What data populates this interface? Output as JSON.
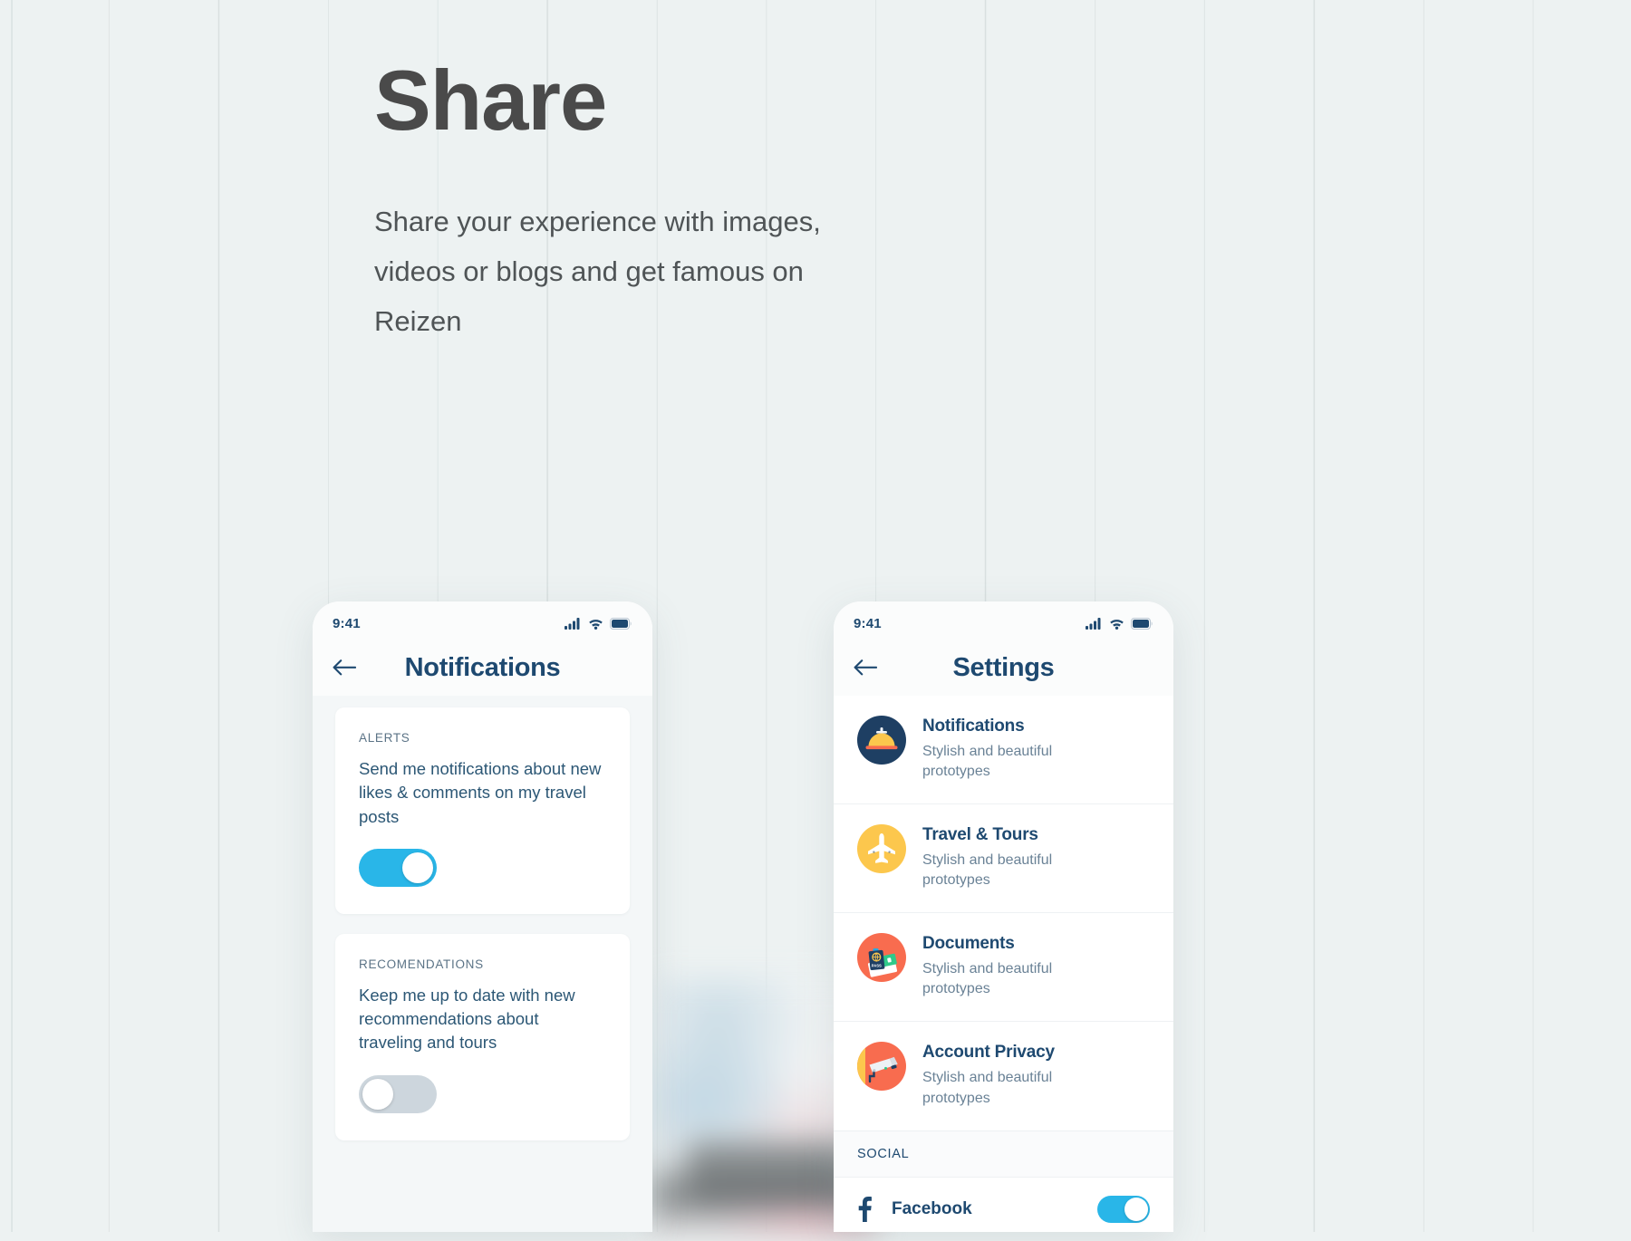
{
  "hero": {
    "title": "Share",
    "subtitle": "Share your experience with images, videos or blogs and get famous on Reizen"
  },
  "colors": {
    "background": "#edf2f2",
    "grid_line": "#d9e0e0",
    "heading": "#4a4a4a",
    "body_text": "#4f5456",
    "navy": "#1e4970",
    "accent_blue": "#29b6e8",
    "toggle_off": "#cdd6dd",
    "icon_yellow": "#fcc74d",
    "icon_orange": "#f86c4f",
    "icon_navy": "#1e3f63",
    "card_bg": "#ffffff",
    "phone_body_bg": "#f4f7f8"
  },
  "phone_notifications": {
    "status": {
      "time": "9:41",
      "signal_icon": "cellular-signal-icon",
      "wifi_icon": "wifi-icon",
      "battery_icon": "battery-icon"
    },
    "nav": {
      "back_icon": "arrow-left-icon",
      "title": "Notifications"
    },
    "cards": [
      {
        "kicker": "ALERTS",
        "text": "Send me notifications about new likes & comments on my travel posts",
        "toggle_state": "on"
      },
      {
        "kicker": "RECOMENDATIONS",
        "text": "Keep me up to date with new recommendations about traveling and tours",
        "toggle_state": "off"
      }
    ]
  },
  "phone_settings": {
    "status": {
      "time": "9:41",
      "signal_icon": "cellular-signal-icon",
      "wifi_icon": "wifi-icon",
      "battery_icon": "battery-icon"
    },
    "nav": {
      "back_icon": "arrow-left-icon",
      "title": "Settings"
    },
    "items": [
      {
        "title": "Notifications",
        "desc": "Stylish and beautiful prototypes",
        "icon": "service-bell-icon",
        "icon_bg": "#1e3f63"
      },
      {
        "title": "Travel & Tours",
        "desc": "Stylish and beautiful prototypes",
        "icon": "airplane-icon",
        "icon_bg": "#fcc74d"
      },
      {
        "title": "Documents",
        "desc": "Stylish and beautiful prototypes",
        "icon": "passport-documents-icon",
        "icon_bg": "#f86c4f"
      },
      {
        "title": "Account Privacy",
        "desc": "Stylish and beautiful prototypes",
        "icon": "security-camera-icon",
        "icon_bg": "#f86c4f"
      }
    ],
    "social_section": {
      "header": "SOCIAL",
      "rows": [
        {
          "name": "Facebook",
          "icon": "facebook-icon",
          "toggle_state": "on"
        }
      ]
    }
  }
}
